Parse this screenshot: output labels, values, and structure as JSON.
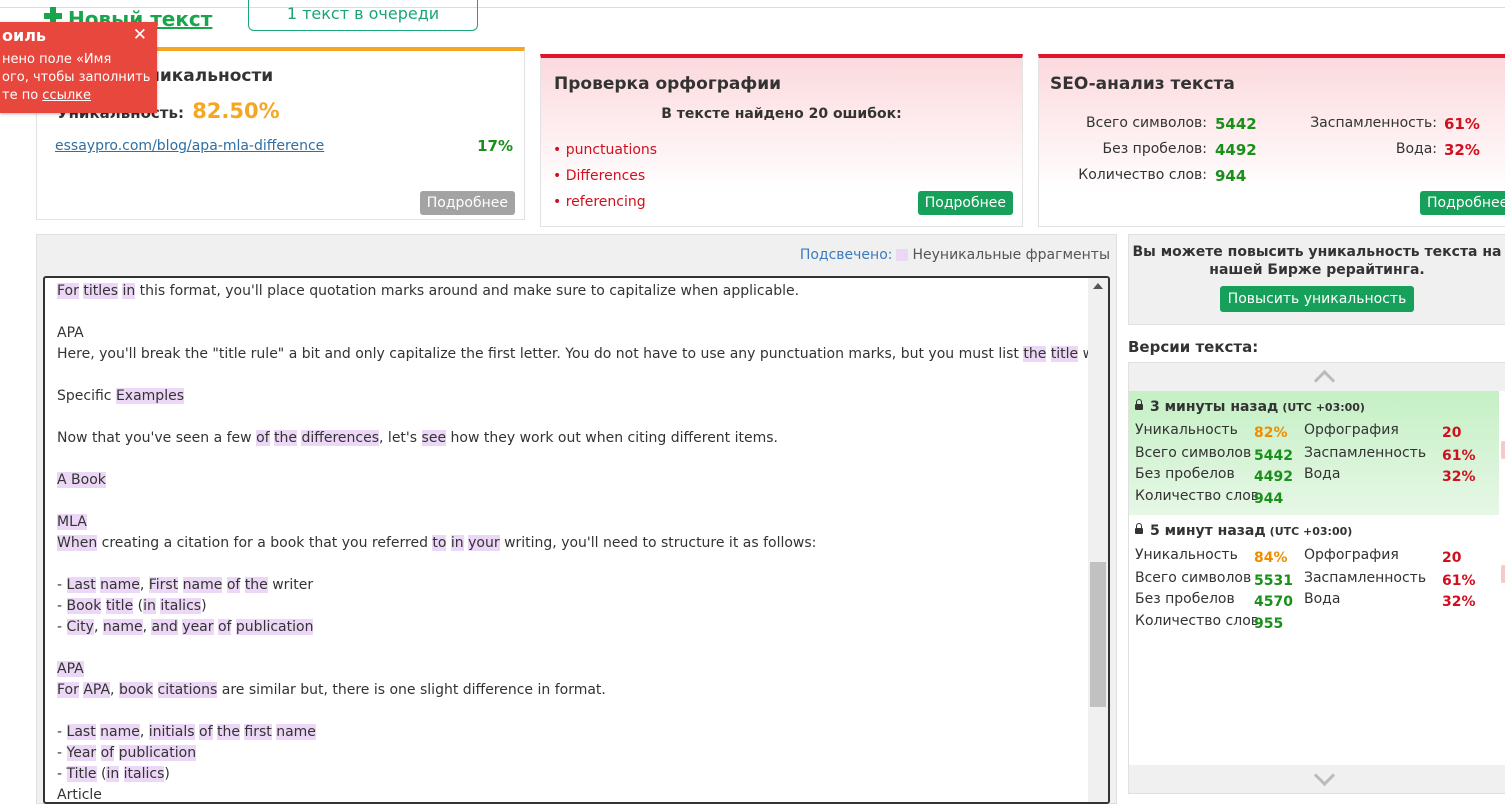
{
  "header": {
    "new_text": "Новый текст",
    "queue": "1 текст в очереди"
  },
  "toast": {
    "title": "оиль",
    "line1": "нено поле «Имя",
    "line2": "ого, чтобы заполнить",
    "line3_prefix": "те по",
    "line3_link": "ссылке"
  },
  "uniqueness": {
    "title": "уникальности",
    "label": "Уникальность:",
    "value": "82.50%",
    "source_url": "essaypro.com/blog/apa-mla-difference",
    "source_percent": "17%",
    "more_btn": "Подробнее"
  },
  "spelling": {
    "title": "Проверка орфографии",
    "subtitle": "В тексте найдено 20 ошибок:",
    "errors": [
      "punctuations",
      "Differences",
      "referencing"
    ],
    "more_btn": "Подробнее"
  },
  "seo": {
    "title": "SEO-анализ текста",
    "rows": [
      {
        "label": "Всего символов:",
        "value": "5442"
      },
      {
        "label": "Без пробелов:",
        "value": "4492"
      },
      {
        "label": "Количество слов:",
        "value": "944"
      }
    ],
    "spam_label": "Заспамленность:",
    "spam_value": "61%",
    "water_label": "Вода:",
    "water_value": "32%",
    "more_btn": "Подробнее"
  },
  "editor": {
    "legend_label": "Подсвечено:",
    "legend_text": "Неуникальные фрагменты",
    "lines": [
      [
        {
          "t": "For",
          "h": true
        },
        {
          "t": " "
        },
        {
          "t": "titles",
          "h": true
        },
        {
          "t": " "
        },
        {
          "t": "in",
          "h": true
        },
        {
          "t": " this format, you'll place quotation marks around and make sure to capitalize when applicable."
        }
      ],
      [],
      [
        {
          "t": "APA"
        }
      ],
      [
        {
          "t": "Here, you'll break the \"title rule\" a bit and only capitalize the first letter. You do not have to use any punctuation marks, but you must list "
        },
        {
          "t": "the",
          "h": true
        },
        {
          "t": " "
        },
        {
          "t": "title",
          "h": true
        },
        {
          "t": " within."
        }
      ],
      [],
      [
        {
          "t": "Specific "
        },
        {
          "t": "Examples",
          "h": true
        }
      ],
      [],
      [
        {
          "t": "Now that you've seen a few "
        },
        {
          "t": "of",
          "h": true
        },
        {
          "t": " "
        },
        {
          "t": "the",
          "h": true
        },
        {
          "t": " "
        },
        {
          "t": "differences",
          "h": true
        },
        {
          "t": ", let's "
        },
        {
          "t": "see",
          "h": true
        },
        {
          "t": " how they work out when citing different items."
        }
      ],
      [],
      [
        {
          "t": "A Book",
          "h": true
        }
      ],
      [],
      [
        {
          "t": "MLA",
          "h": true
        }
      ],
      [
        {
          "t": "When",
          "h": true
        },
        {
          "t": " creating a citation for a book that you referred "
        },
        {
          "t": "to",
          "h": true
        },
        {
          "t": " "
        },
        {
          "t": "in",
          "h": true
        },
        {
          "t": " "
        },
        {
          "t": "your",
          "h": true
        },
        {
          "t": " writing, you'll need to structure it as follows:"
        }
      ],
      [],
      [
        {
          "t": "- "
        },
        {
          "t": "Last",
          "h": true
        },
        {
          "t": " "
        },
        {
          "t": "name",
          "h": true
        },
        {
          "t": ", "
        },
        {
          "t": "First",
          "h": true
        },
        {
          "t": " "
        },
        {
          "t": "name",
          "h": true
        },
        {
          "t": " "
        },
        {
          "t": "of",
          "h": true
        },
        {
          "t": " "
        },
        {
          "t": "the",
          "h": true
        },
        {
          "t": " writer"
        }
      ],
      [
        {
          "t": "- "
        },
        {
          "t": "Book",
          "h": true
        },
        {
          "t": " "
        },
        {
          "t": "title",
          "h": true
        },
        {
          "t": " ("
        },
        {
          "t": "in",
          "h": true
        },
        {
          "t": " "
        },
        {
          "t": "italics",
          "h": true
        },
        {
          "t": ")"
        }
      ],
      [
        {
          "t": "- "
        },
        {
          "t": "City",
          "h": true
        },
        {
          "t": ", "
        },
        {
          "t": "name",
          "h": true
        },
        {
          "t": ", "
        },
        {
          "t": "and",
          "h": true
        },
        {
          "t": " "
        },
        {
          "t": "year",
          "h": true
        },
        {
          "t": " "
        },
        {
          "t": "of",
          "h": true
        },
        {
          "t": " "
        },
        {
          "t": "publication",
          "h": true
        }
      ],
      [],
      [
        {
          "t": "APA",
          "h": true
        }
      ],
      [
        {
          "t": "For",
          "h": true
        },
        {
          "t": " "
        },
        {
          "t": "APA",
          "h": true
        },
        {
          "t": ", "
        },
        {
          "t": "book",
          "h": true
        },
        {
          "t": " "
        },
        {
          "t": "citations",
          "h": true
        },
        {
          "t": " are similar but, there is one slight difference in format."
        }
      ],
      [],
      [
        {
          "t": "- "
        },
        {
          "t": "Last",
          "h": true
        },
        {
          "t": " "
        },
        {
          "t": "name",
          "h": true
        },
        {
          "t": ", "
        },
        {
          "t": "initials",
          "h": true
        },
        {
          "t": " "
        },
        {
          "t": "of",
          "h": true
        },
        {
          "t": " "
        },
        {
          "t": "the",
          "h": true
        },
        {
          "t": " "
        },
        {
          "t": "first",
          "h": true
        },
        {
          "t": " "
        },
        {
          "t": "name",
          "h": true
        }
      ],
      [
        {
          "t": "- "
        },
        {
          "t": "Year",
          "h": true
        },
        {
          "t": " "
        },
        {
          "t": "of",
          "h": true
        },
        {
          "t": " "
        },
        {
          "t": "publication",
          "h": true
        }
      ],
      [
        {
          "t": "- "
        },
        {
          "t": "Title",
          "h": true
        },
        {
          "t": " ("
        },
        {
          "t": "in",
          "h": true
        },
        {
          "t": " "
        },
        {
          "t": "italics",
          "h": true
        },
        {
          "t": ")"
        }
      ],
      [
        {
          "t": "Article"
        }
      ]
    ]
  },
  "promo": {
    "text_line1": "Вы можете повысить уникальность текста на",
    "text_line2": "нашей Бирже рерайтинга.",
    "button": "Повысить уникальность"
  },
  "versions": {
    "label": "Версии текста:",
    "items": [
      {
        "time": "3 минуты назад",
        "tz": "(UTC +03:00)",
        "uniqueness_label": "Уникальность",
        "uniqueness": "82%",
        "chars_label": "Всего символов",
        "chars": "5442",
        "nospace_label": "Без пробелов",
        "nospace": "4492",
        "words_label": "Количество слов",
        "words": "944",
        "spelling_label": "Орфография",
        "spelling": "20",
        "spam_label": "Заспамленность",
        "spam": "61%",
        "water_label": "Вода",
        "water": "32%"
      },
      {
        "time": "5 минут назад",
        "tz": "(UTC +03:00)",
        "uniqueness_label": "Уникальность",
        "uniqueness": "84%",
        "chars_label": "Всего символов",
        "chars": "5531",
        "nospace_label": "Без пробелов",
        "nospace": "4570",
        "words_label": "Количество слов",
        "words": "955",
        "spelling_label": "Орфография",
        "spelling": "20",
        "spam_label": "Заспамленность",
        "spam": "61%",
        "water_label": "Вода",
        "water": "32%"
      }
    ]
  },
  "colors": {
    "accent_green": "#16a05a",
    "uniqueness_orange": "#f5a623",
    "error_red": "#e0142b",
    "highlight": "#ecd7f6"
  }
}
